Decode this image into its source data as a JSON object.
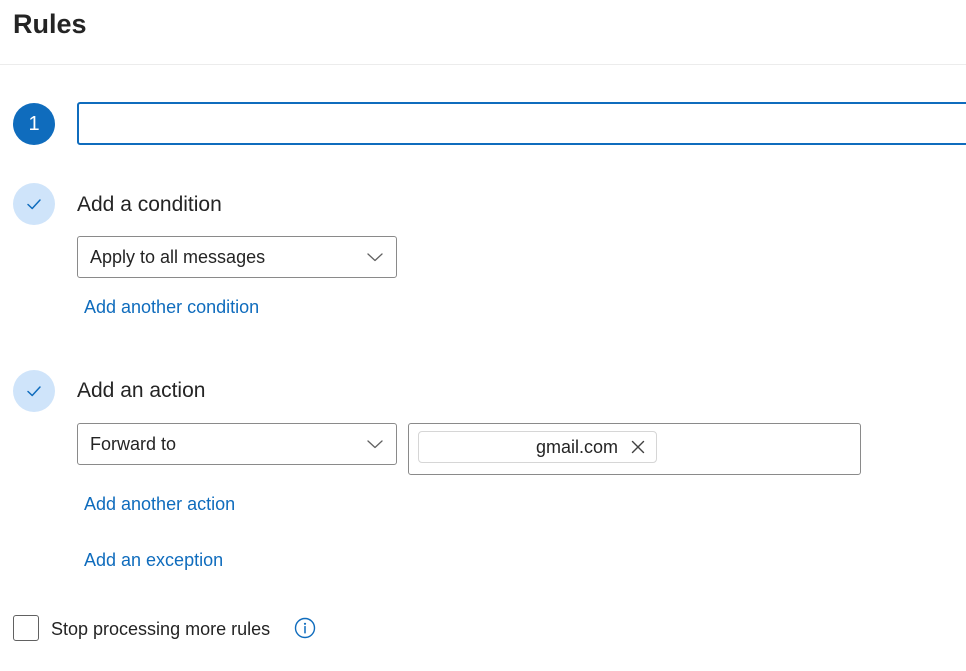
{
  "page": {
    "title": "Rules"
  },
  "step1": {
    "number": "1",
    "name_value": "",
    "name_placeholder": ""
  },
  "condition": {
    "title": "Add a condition",
    "dropdown_value": "Apply to all messages",
    "add_another_label": "Add another condition"
  },
  "action": {
    "title": "Add an action",
    "dropdown_value": "Forward to",
    "recipient_chip": "gmail.com",
    "add_another_label": "Add another action",
    "add_exception_label": "Add an exception"
  },
  "footer": {
    "stop_processing_label": "Stop processing more rules",
    "stop_processing_checked": false
  },
  "icons": {
    "step_done": "checkmark-icon",
    "dropdown": "chevron-down-icon",
    "chip_remove": "close-icon",
    "info": "info-icon"
  },
  "colors": {
    "accent": "#0f6cbd",
    "step_done_bg": "#cfe4fa",
    "text": "#242424",
    "border": "#8a8a8a"
  }
}
